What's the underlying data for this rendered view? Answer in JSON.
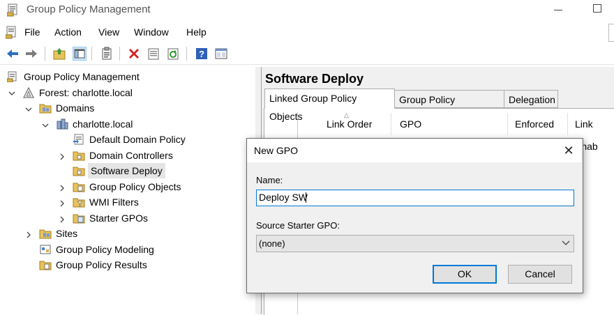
{
  "window": {
    "title": "Group Policy Management",
    "icon": "gpmc-app-icon"
  },
  "menu": {
    "items": [
      "File",
      "Action",
      "View",
      "Window",
      "Help"
    ]
  },
  "toolbar": {
    "icons": [
      "back-arrow-icon",
      "forward-arrow-icon",
      "up-folder-icon",
      "show-hide-tree-icon",
      "properties-icon",
      "delete-icon",
      "export-icon",
      "refresh-icon",
      "help-icon",
      "console-icon"
    ]
  },
  "tree": {
    "root": "Group Policy Management",
    "forest": "Forest: charlotte.local",
    "domains": "Domains",
    "domain": "charlotte.local",
    "default_policy": "Default Domain Policy",
    "domain_controllers": "Domain Controllers",
    "software_deploy": "Software Deploy",
    "gpo": "Group Policy Objects",
    "wmi": "WMI Filters",
    "starter": "Starter GPOs",
    "sites": "Sites",
    "modeling": "Group Policy Modeling",
    "results": "Group Policy Results",
    "selected": "Software Deploy"
  },
  "details": {
    "title": "Software Deploy",
    "tabs": [
      "Linked Group Policy Objects",
      "Group Policy Inheritance",
      "Delegation"
    ],
    "active_tab": "Linked Group Policy Objects",
    "columns": [
      "Link Order",
      "GPO",
      "Enforced",
      "Link Enab"
    ]
  },
  "dialog": {
    "title": "New GPO",
    "name_label": "Name:",
    "name_value": "Deploy SW",
    "starter_label": "Source Starter GPO:",
    "starter_value": "(none)",
    "ok": "OK",
    "cancel": "Cancel"
  },
  "colors": {
    "accent": "#0078d7",
    "pane_bg": "#f0f0f0",
    "selection": "#e5e5e5"
  }
}
